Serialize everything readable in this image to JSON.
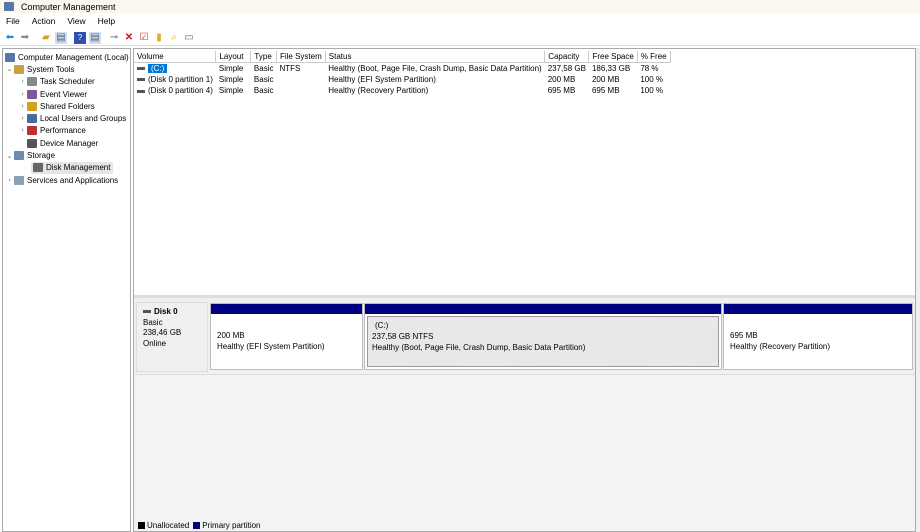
{
  "window": {
    "title": "Computer Management"
  },
  "menu": [
    "File",
    "Action",
    "View",
    "Help"
  ],
  "toolbar": {
    "icons": [
      "back-icon",
      "forward-icon",
      "up-folder-icon",
      "show-hide-tree-icon",
      "help-icon",
      "console-icon",
      "connect-icon",
      "delete-icon",
      "properties-icon",
      "new-icon",
      "search-icon",
      "view-icon"
    ]
  },
  "tree": [
    {
      "label": "Computer Management (Local)",
      "level": 0,
      "chev": "",
      "color": "#5577aa"
    },
    {
      "label": "System Tools",
      "level": 0,
      "chev": "⌄",
      "color": "#c8a040"
    },
    {
      "label": "Task Scheduler",
      "level": 1,
      "chev": "›",
      "color": "#888"
    },
    {
      "label": "Event Viewer",
      "level": 1,
      "chev": "›",
      "color": "#7a5a9a"
    },
    {
      "label": "Shared Folders",
      "level": 1,
      "chev": "›",
      "color": "#d4a020"
    },
    {
      "label": "Local Users and Groups",
      "level": 1,
      "chev": "›",
      "color": "#4a6aa0"
    },
    {
      "label": "Performance",
      "level": 1,
      "chev": "›",
      "color": "#c03030"
    },
    {
      "label": "Device Manager",
      "level": 1,
      "chev": "",
      "color": "#555"
    },
    {
      "label": "Storage",
      "level": 0,
      "chev": "⌄",
      "color": "#6a8ab0"
    },
    {
      "label": "Disk Management",
      "level": 1,
      "chev": "",
      "color": "#666",
      "selected": true
    },
    {
      "label": "Services and Applications",
      "level": 0,
      "chev": "›",
      "color": "#8aa0b8"
    }
  ],
  "volumes": {
    "columns": [
      "Volume",
      "Layout",
      "Type",
      "File System",
      "Status",
      "Capacity",
      "Free Space",
      "% Free"
    ],
    "rows": [
      [
        "(C:)",
        "Simple",
        "Basic",
        "NTFS",
        "Healthy (Boot, Page File, Crash Dump, Basic Data Partition)",
        "237,58 GB",
        "186,33 GB",
        "78 %"
      ],
      [
        "(Disk 0 partition 1)",
        "Simple",
        "Basic",
        "",
        "Healthy (EFI System Partition)",
        "200 MB",
        "200 MB",
        "100 %"
      ],
      [
        "(Disk 0 partition 4)",
        "Simple",
        "Basic",
        "",
        "Healthy (Recovery Partition)",
        "695 MB",
        "695 MB",
        "100 %"
      ]
    ]
  },
  "disk": {
    "name": "Disk 0",
    "type": "Basic",
    "size": "238,46 GB",
    "status": "Online",
    "partitions": [
      {
        "name": "",
        "size": "200 MB",
        "status": "Healthy (EFI System Partition)"
      },
      {
        "name": "(C:)",
        "size": "237,58 GB NTFS",
        "status": "Healthy (Boot, Page File, Crash Dump, Basic Data Partition)"
      },
      {
        "name": "",
        "size": "695 MB",
        "status": "Healthy (Recovery Partition)"
      }
    ]
  },
  "legend": [
    {
      "label": "Unallocated",
      "color": "#000000"
    },
    {
      "label": "Primary partition",
      "color": "#000080"
    }
  ]
}
